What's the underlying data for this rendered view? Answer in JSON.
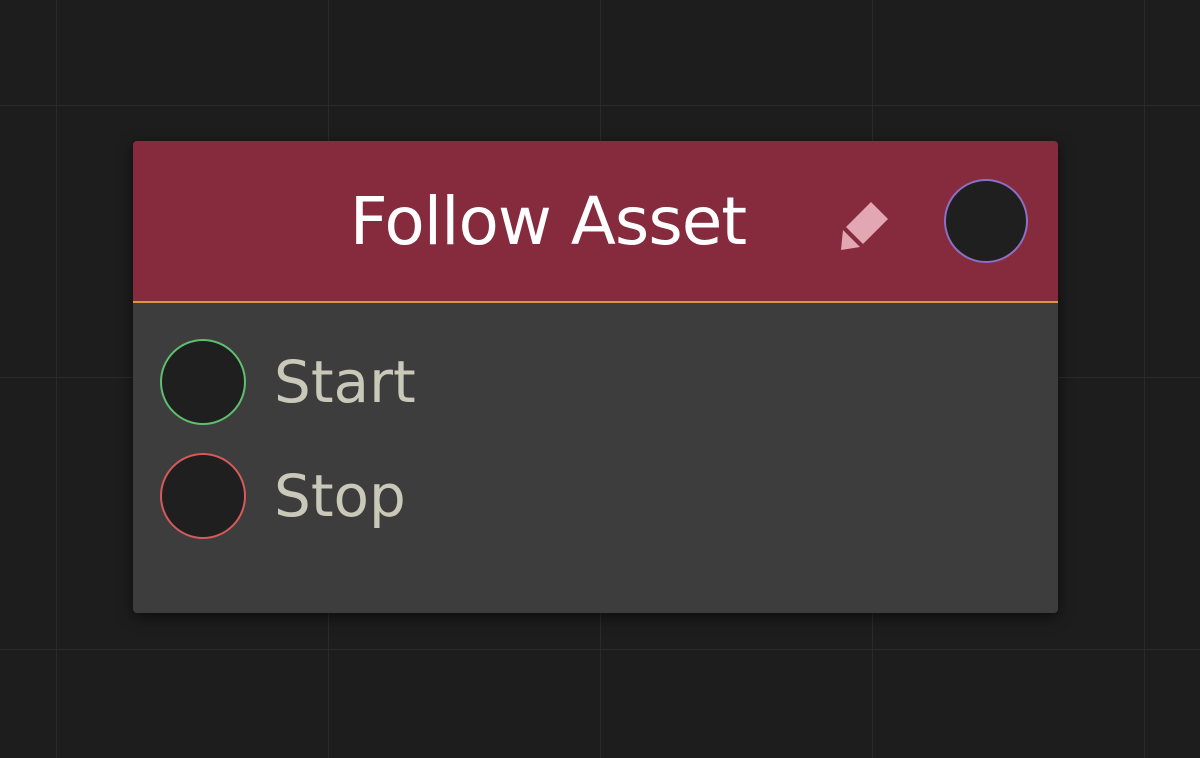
{
  "node": {
    "title": "Follow Asset",
    "header_color": "#862b3e",
    "header_border_color": "#d49a3a",
    "body_color": "#3d3d3d",
    "edit_icon": "pencil-icon",
    "output_socket_color": "#8b6fc4",
    "inputs": [
      {
        "label": "Start",
        "socket_color": "#5fbf6f"
      },
      {
        "label": "Stop",
        "socket_color": "#d65a5a"
      }
    ]
  },
  "canvas": {
    "background_color": "#1d1d1d",
    "grid_color": "#2b2b2b"
  }
}
